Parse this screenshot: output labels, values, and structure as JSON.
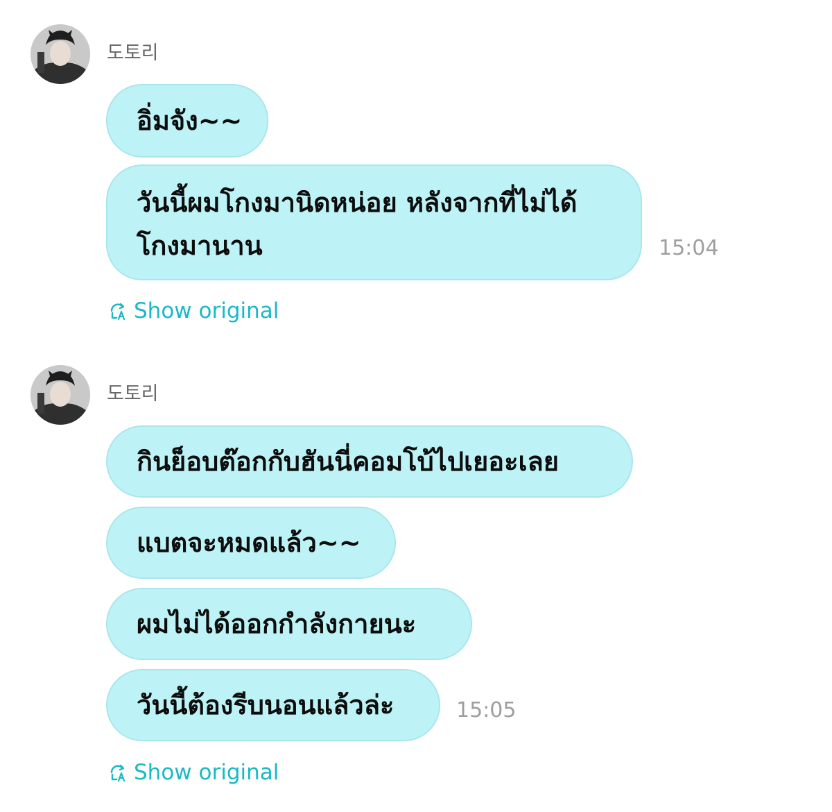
{
  "groups": [
    {
      "sender": "도토리",
      "messages": [
        "อิ่มจัง~~",
        "วันนี้ผมโกงมานิดหน่อย หลังจากที่ไม่ได้โกงมานาน"
      ],
      "time": "15:04",
      "show_original_label": "Show original"
    },
    {
      "sender": "도토리",
      "messages": [
        "กินย็อบต๊อกกับฮันนี่คอมโบ้ไปเยอะเลย",
        "แบตจะหมดแล้ว~~",
        "ผมไม่ได้ออกกำลังกายนะ",
        "วันนี้ต้องรีบนอนแล้วล่ะ"
      ],
      "time": "15:05",
      "show_original_label": "Show original"
    }
  ],
  "icons": {
    "avatar": "avatar-photo",
    "translate": "translate-icon"
  },
  "colors": {
    "bubble": "#bdf3f6",
    "bubble_border": "#a9e6ec",
    "accent": "#19b9c5",
    "timestamp": "#9e9e9e",
    "sender": "#666666"
  }
}
